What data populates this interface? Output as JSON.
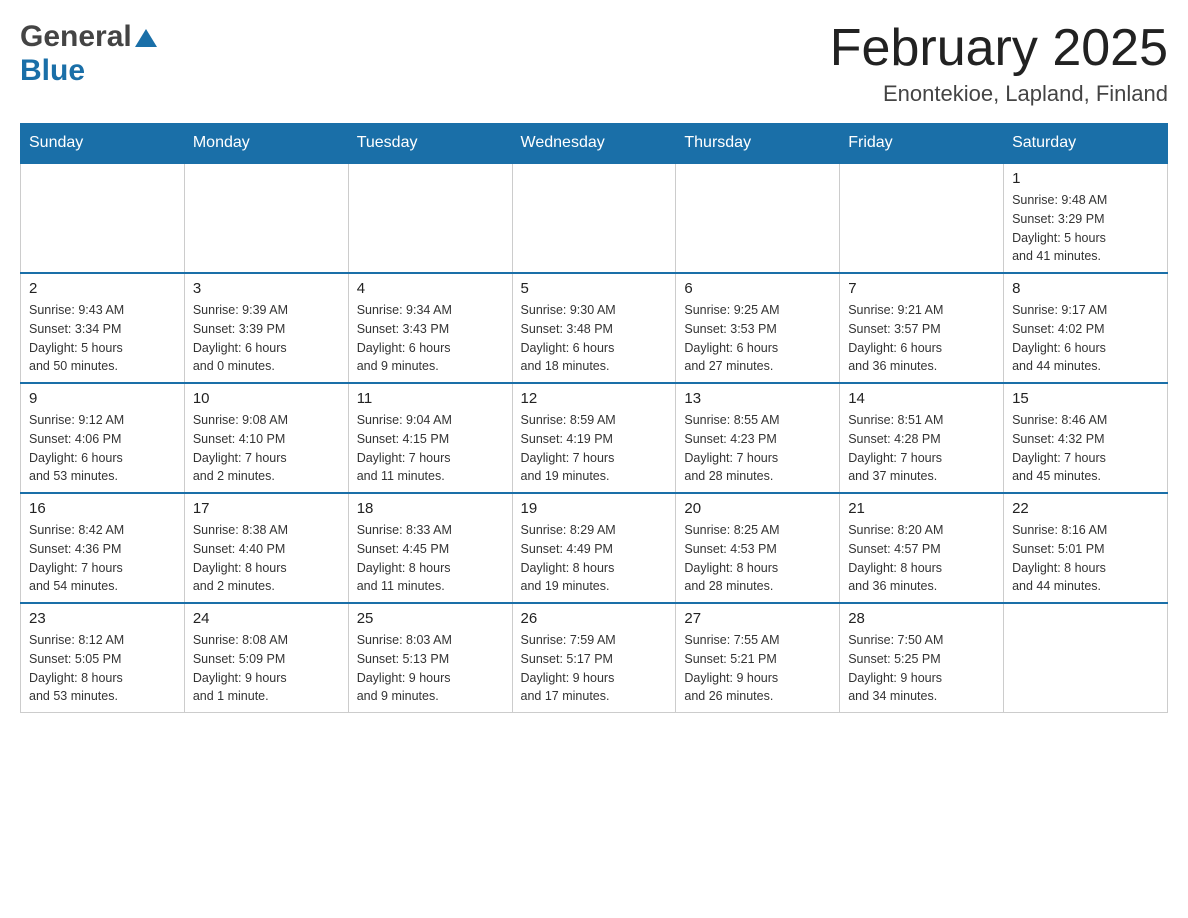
{
  "header": {
    "title": "February 2025",
    "subtitle": "Enontekioe, Lapland, Finland",
    "logo_general": "General",
    "logo_blue": "Blue"
  },
  "weekdays": [
    "Sunday",
    "Monday",
    "Tuesday",
    "Wednesday",
    "Thursday",
    "Friday",
    "Saturday"
  ],
  "weeks": [
    {
      "days": [
        {
          "number": "",
          "info": "",
          "empty": true
        },
        {
          "number": "",
          "info": "",
          "empty": true
        },
        {
          "number": "",
          "info": "",
          "empty": true
        },
        {
          "number": "",
          "info": "",
          "empty": true
        },
        {
          "number": "",
          "info": "",
          "empty": true
        },
        {
          "number": "",
          "info": "",
          "empty": true
        },
        {
          "number": "1",
          "info": "Sunrise: 9:48 AM\nSunset: 3:29 PM\nDaylight: 5 hours\nand 41 minutes.",
          "empty": false
        }
      ]
    },
    {
      "days": [
        {
          "number": "2",
          "info": "Sunrise: 9:43 AM\nSunset: 3:34 PM\nDaylight: 5 hours\nand 50 minutes.",
          "empty": false
        },
        {
          "number": "3",
          "info": "Sunrise: 9:39 AM\nSunset: 3:39 PM\nDaylight: 6 hours\nand 0 minutes.",
          "empty": false
        },
        {
          "number": "4",
          "info": "Sunrise: 9:34 AM\nSunset: 3:43 PM\nDaylight: 6 hours\nand 9 minutes.",
          "empty": false
        },
        {
          "number": "5",
          "info": "Sunrise: 9:30 AM\nSunset: 3:48 PM\nDaylight: 6 hours\nand 18 minutes.",
          "empty": false
        },
        {
          "number": "6",
          "info": "Sunrise: 9:25 AM\nSunset: 3:53 PM\nDaylight: 6 hours\nand 27 minutes.",
          "empty": false
        },
        {
          "number": "7",
          "info": "Sunrise: 9:21 AM\nSunset: 3:57 PM\nDaylight: 6 hours\nand 36 minutes.",
          "empty": false
        },
        {
          "number": "8",
          "info": "Sunrise: 9:17 AM\nSunset: 4:02 PM\nDaylight: 6 hours\nand 44 minutes.",
          "empty": false
        }
      ]
    },
    {
      "days": [
        {
          "number": "9",
          "info": "Sunrise: 9:12 AM\nSunset: 4:06 PM\nDaylight: 6 hours\nand 53 minutes.",
          "empty": false
        },
        {
          "number": "10",
          "info": "Sunrise: 9:08 AM\nSunset: 4:10 PM\nDaylight: 7 hours\nand 2 minutes.",
          "empty": false
        },
        {
          "number": "11",
          "info": "Sunrise: 9:04 AM\nSunset: 4:15 PM\nDaylight: 7 hours\nand 11 minutes.",
          "empty": false
        },
        {
          "number": "12",
          "info": "Sunrise: 8:59 AM\nSunset: 4:19 PM\nDaylight: 7 hours\nand 19 minutes.",
          "empty": false
        },
        {
          "number": "13",
          "info": "Sunrise: 8:55 AM\nSunset: 4:23 PM\nDaylight: 7 hours\nand 28 minutes.",
          "empty": false
        },
        {
          "number": "14",
          "info": "Sunrise: 8:51 AM\nSunset: 4:28 PM\nDaylight: 7 hours\nand 37 minutes.",
          "empty": false
        },
        {
          "number": "15",
          "info": "Sunrise: 8:46 AM\nSunset: 4:32 PM\nDaylight: 7 hours\nand 45 minutes.",
          "empty": false
        }
      ]
    },
    {
      "days": [
        {
          "number": "16",
          "info": "Sunrise: 8:42 AM\nSunset: 4:36 PM\nDaylight: 7 hours\nand 54 minutes.",
          "empty": false
        },
        {
          "number": "17",
          "info": "Sunrise: 8:38 AM\nSunset: 4:40 PM\nDaylight: 8 hours\nand 2 minutes.",
          "empty": false
        },
        {
          "number": "18",
          "info": "Sunrise: 8:33 AM\nSunset: 4:45 PM\nDaylight: 8 hours\nand 11 minutes.",
          "empty": false
        },
        {
          "number": "19",
          "info": "Sunrise: 8:29 AM\nSunset: 4:49 PM\nDaylight: 8 hours\nand 19 minutes.",
          "empty": false
        },
        {
          "number": "20",
          "info": "Sunrise: 8:25 AM\nSunset: 4:53 PM\nDaylight: 8 hours\nand 28 minutes.",
          "empty": false
        },
        {
          "number": "21",
          "info": "Sunrise: 8:20 AM\nSunset: 4:57 PM\nDaylight: 8 hours\nand 36 minutes.",
          "empty": false
        },
        {
          "number": "22",
          "info": "Sunrise: 8:16 AM\nSunset: 5:01 PM\nDaylight: 8 hours\nand 44 minutes.",
          "empty": false
        }
      ]
    },
    {
      "days": [
        {
          "number": "23",
          "info": "Sunrise: 8:12 AM\nSunset: 5:05 PM\nDaylight: 8 hours\nand 53 minutes.",
          "empty": false
        },
        {
          "number": "24",
          "info": "Sunrise: 8:08 AM\nSunset: 5:09 PM\nDaylight: 9 hours\nand 1 minute.",
          "empty": false
        },
        {
          "number": "25",
          "info": "Sunrise: 8:03 AM\nSunset: 5:13 PM\nDaylight: 9 hours\nand 9 minutes.",
          "empty": false
        },
        {
          "number": "26",
          "info": "Sunrise: 7:59 AM\nSunset: 5:17 PM\nDaylight: 9 hours\nand 17 minutes.",
          "empty": false
        },
        {
          "number": "27",
          "info": "Sunrise: 7:55 AM\nSunset: 5:21 PM\nDaylight: 9 hours\nand 26 minutes.",
          "empty": false
        },
        {
          "number": "28",
          "info": "Sunrise: 7:50 AM\nSunset: 5:25 PM\nDaylight: 9 hours\nand 34 minutes.",
          "empty": false
        },
        {
          "number": "",
          "info": "",
          "empty": true
        }
      ]
    }
  ]
}
